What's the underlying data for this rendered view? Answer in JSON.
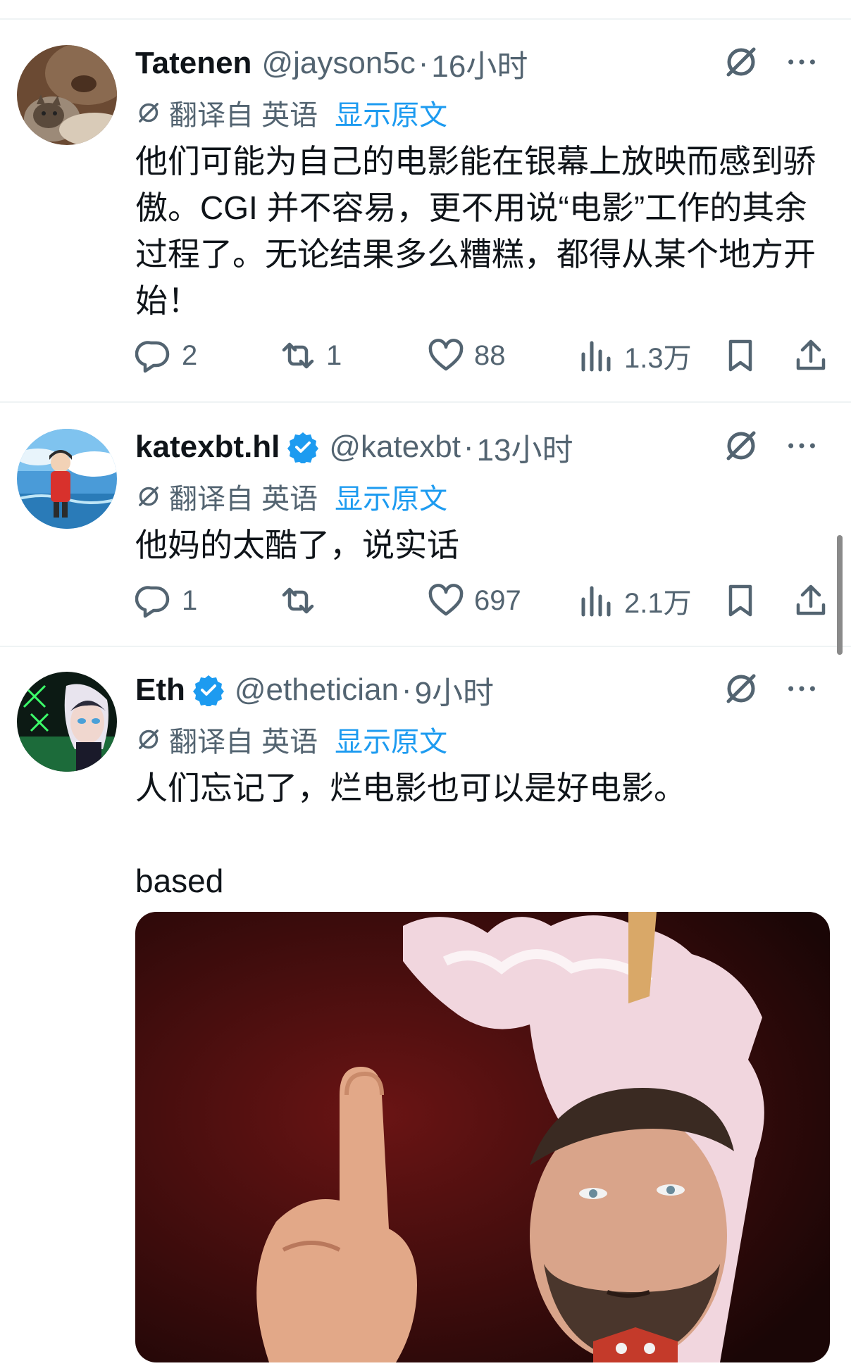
{
  "tweets": [
    {
      "name": "Tatenen",
      "verified": false,
      "handle": "@jayson5c",
      "time": "16小时",
      "translate_label": "翻译自 英语",
      "show_original": "显示原文",
      "text": "他们可能为自己的电影能在银幕上放映而感到骄傲。CGI 并不容易，更不用说“电影”工作的其余过程了。无论结果多么糟糕，都得从某个地方开始！",
      "replies": "2",
      "reposts": "1",
      "likes": "88",
      "views": "1.3万",
      "avatar_icon": "cat-avatar"
    },
    {
      "name": "katexbt.hl",
      "verified": true,
      "handle": "@katexbt",
      "time": "13小时",
      "translate_label": "翻译自 英语",
      "show_original": "显示原文",
      "text": "他妈的太酷了，说实话",
      "replies": "1",
      "reposts": "",
      "likes": "697",
      "views": "2.1万",
      "avatar_icon": "anime-girl-avatar"
    },
    {
      "name": "Eth",
      "verified": true,
      "handle": "@ethetician",
      "time": "9小时",
      "translate_label": "翻译自 英语",
      "show_original": "显示原文",
      "text": "人们忘记了，烂电影也可以是好电影。\n\nbased",
      "avatar_icon": "anime-character-avatar",
      "media": "pointing-man-in-unicorn-hood-meme"
    }
  ],
  "colors": {
    "accent": "#1d9bf0",
    "secondary_text": "#536471",
    "primary_text": "#0f1419",
    "divider": "#eff3f4"
  },
  "icons": [
    "grok-icon",
    "more-icon",
    "translate-icon",
    "reply-icon",
    "repost-icon",
    "like-icon",
    "views-icon",
    "bookmark-icon",
    "share-icon",
    "verified-badge-icon"
  ]
}
